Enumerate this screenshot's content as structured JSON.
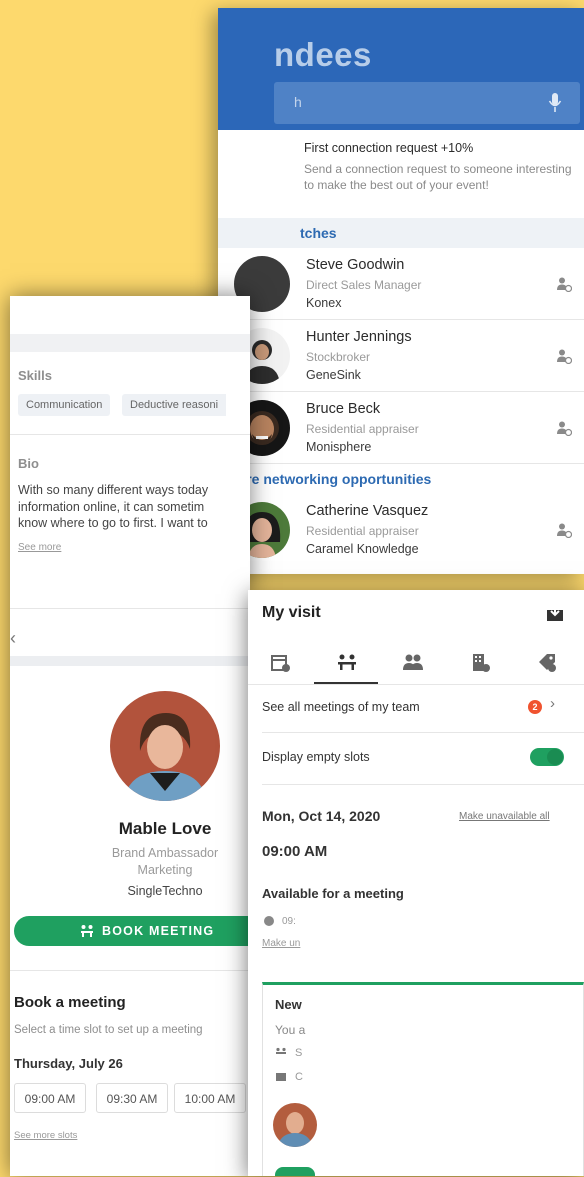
{
  "attendees": {
    "title": "ndees",
    "search_placeholder": "h",
    "promo_title": "First connection request +10%",
    "promo_line1": "Send a connection request to someone interesting",
    "promo_line2": "to make the best out of your event!",
    "section_matches": "tches",
    "section_more": "More networking opportunities",
    "people": [
      {
        "name": "Steve Goodwin",
        "job": "Direct Sales Manager",
        "company": "Konex"
      },
      {
        "name": "Hunter Jennings",
        "job": "Stockbroker",
        "company": "GeneSink"
      },
      {
        "name": "Bruce Beck",
        "job": "Residential appraiser",
        "company": "Monisphere"
      },
      {
        "name": "Catherine Vasquez",
        "job": "Residential appraiser",
        "company": "Caramel Knowledge"
      }
    ]
  },
  "profile": {
    "skills_label": "Skills",
    "skills": [
      "Communication",
      "Deductive reasoni"
    ],
    "bio_label": "Bio",
    "bio_lines": [
      "With so many different ways today",
      "information online, it can sometim",
      "know where to go to first. I want to"
    ],
    "see_more": "See more",
    "name": "Mable Love",
    "role": "Brand Ambassador",
    "department": "Marketing",
    "company": "SingleTechno",
    "book_button": "BOOK MEETING",
    "book_title": "Book a meeting",
    "book_subtitle": "Select a time slot to set up a meeting",
    "book_day": "Thursday, July 26",
    "slots": [
      "09:00 AM",
      "09:30 AM",
      "10:00 AM"
    ],
    "more_slots": "See more slots"
  },
  "visit": {
    "title": "My visit",
    "team_meetings": "See all meetings of my team",
    "team_badge": "2",
    "empty_slots": "Display empty slots",
    "date": "Mon, Oct 14, 2020",
    "make_unavailable": "Make unavailable all",
    "time": "09:00 AM",
    "available": "Available for a meeting",
    "avail_time": "09:",
    "make_short": "Make un",
    "new_title": "New",
    "new_you": "You a",
    "new_s": "S",
    "new_c": "C"
  },
  "colors": {
    "background": "#fdd96d",
    "header_blue": "#2c67b8",
    "accent_green": "#1fa060",
    "link_blue": "#2d6ab2",
    "badge_orange": "#f0532f"
  }
}
